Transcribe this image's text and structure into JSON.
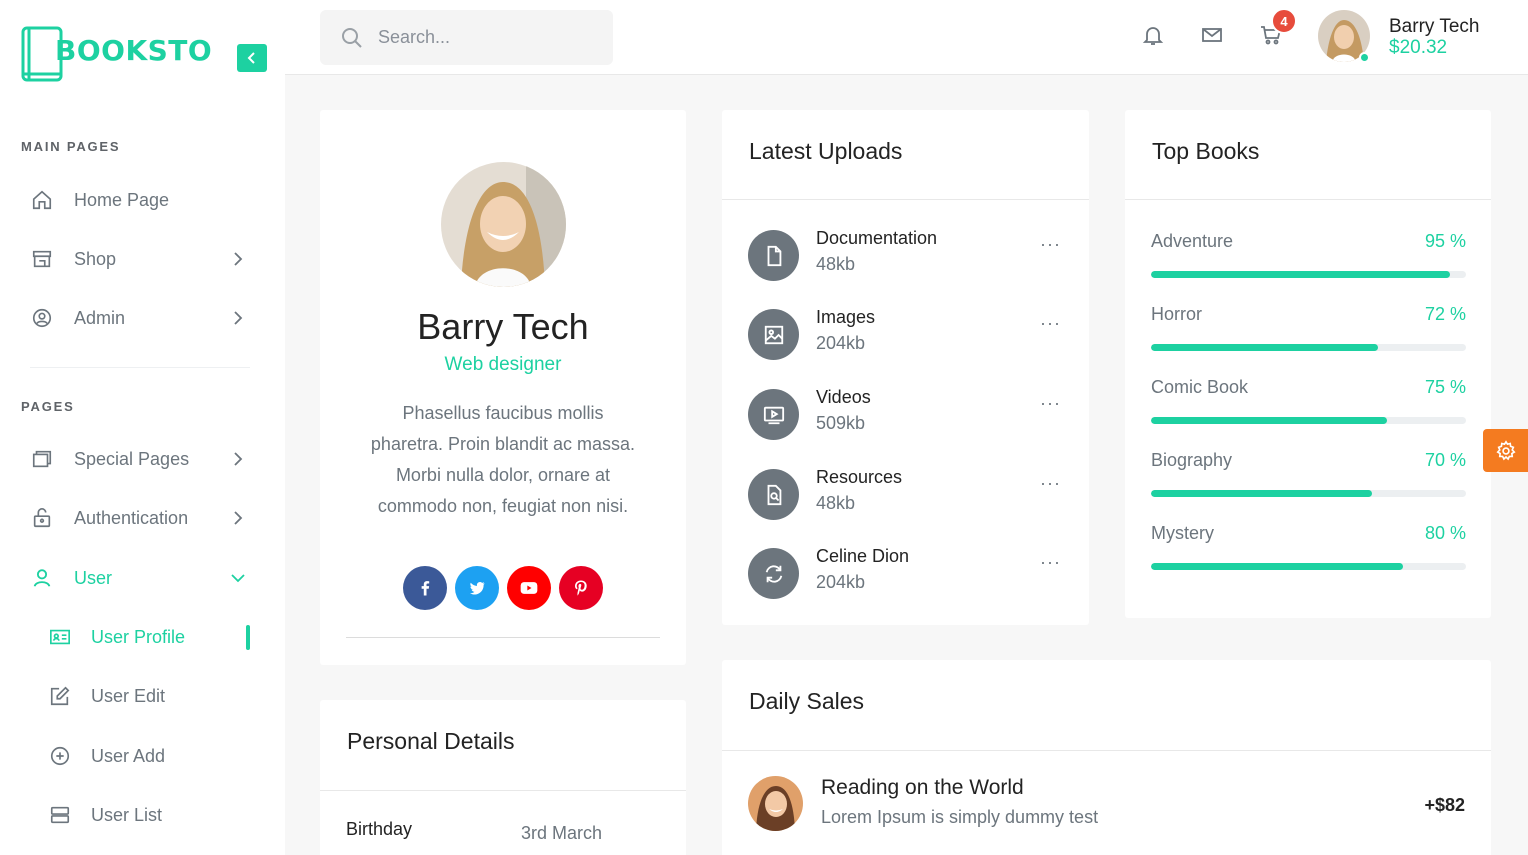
{
  "brand": {
    "logo_text": "BOOKSTO",
    "accent": "#1dd1a1"
  },
  "sidebar": {
    "section_main": "MAIN PAGES",
    "section_pages": "PAGES",
    "main_items": [
      {
        "label": "Home Page",
        "icon": "home-icon"
      },
      {
        "label": "Shop",
        "icon": "store-icon"
      },
      {
        "label": "Admin",
        "icon": "admin-icon"
      }
    ],
    "page_items": [
      {
        "label": "Special Pages",
        "icon": "pages-icon"
      },
      {
        "label": "Authentication",
        "icon": "lock-icon"
      },
      {
        "label": "User",
        "icon": "user-icon"
      }
    ],
    "user_sub": [
      {
        "label": "User Profile",
        "icon": "id-card-icon"
      },
      {
        "label": "User Edit",
        "icon": "edit-icon"
      },
      {
        "label": "User Add",
        "icon": "plus-circle-icon"
      },
      {
        "label": "User List",
        "icon": "list-icon"
      }
    ]
  },
  "header": {
    "search_placeholder": "Search...",
    "cart_count": "4",
    "user_name": "Barry Tech",
    "balance": "$20.32"
  },
  "profile": {
    "name": "Barry Tech",
    "role": "Web designer",
    "bio": "Phasellus faucibus mollis pharetra. Proin blandit ac massa. Morbi nulla dolor, ornare at commodo non, feugiat non nisi.",
    "socials": [
      {
        "icon": "facebook-icon",
        "color": "#3b5998"
      },
      {
        "icon": "twitter-icon",
        "color": "#1da1f2"
      },
      {
        "icon": "youtube-icon",
        "color": "#ff0000"
      },
      {
        "icon": "pinterest-icon",
        "color": "#e60023"
      }
    ]
  },
  "uploads": {
    "title": "Latest Uploads",
    "items": [
      {
        "name": "Documentation",
        "size": "48kb",
        "icon": "file-icon",
        "more": "···"
      },
      {
        "name": "Images",
        "size": "204kb",
        "icon": "image-icon",
        "more": "···"
      },
      {
        "name": "Videos",
        "size": "509kb",
        "icon": "video-icon",
        "more": "···"
      },
      {
        "name": "Resources",
        "size": "48kb",
        "icon": "resource-icon",
        "more": "···"
      },
      {
        "name": "Celine Dion",
        "size": "204kb",
        "icon": "refresh-icon",
        "more": "···"
      }
    ]
  },
  "top_books": {
    "title": "Top Books",
    "items": [
      {
        "name": "Adventure",
        "percent_label": "95 %",
        "percent": 95
      },
      {
        "name": "Horror",
        "percent_label": "72 %",
        "percent": 72
      },
      {
        "name": "Comic Book",
        "percent_label": "75 %",
        "percent": 75
      },
      {
        "name": "Biography",
        "percent_label": "70 %",
        "percent": 70
      },
      {
        "name": "Mystery",
        "percent_label": "80 %",
        "percent": 80
      }
    ]
  },
  "personal": {
    "title": "Personal Details",
    "birthday_label": "Birthday",
    "birthday_value": "3rd March"
  },
  "daily_sales": {
    "title": "Daily Sales",
    "item_title": "Reading on the World",
    "item_sub": "Lorem Ipsum is simply dummy test",
    "item_amount": "+$82"
  }
}
